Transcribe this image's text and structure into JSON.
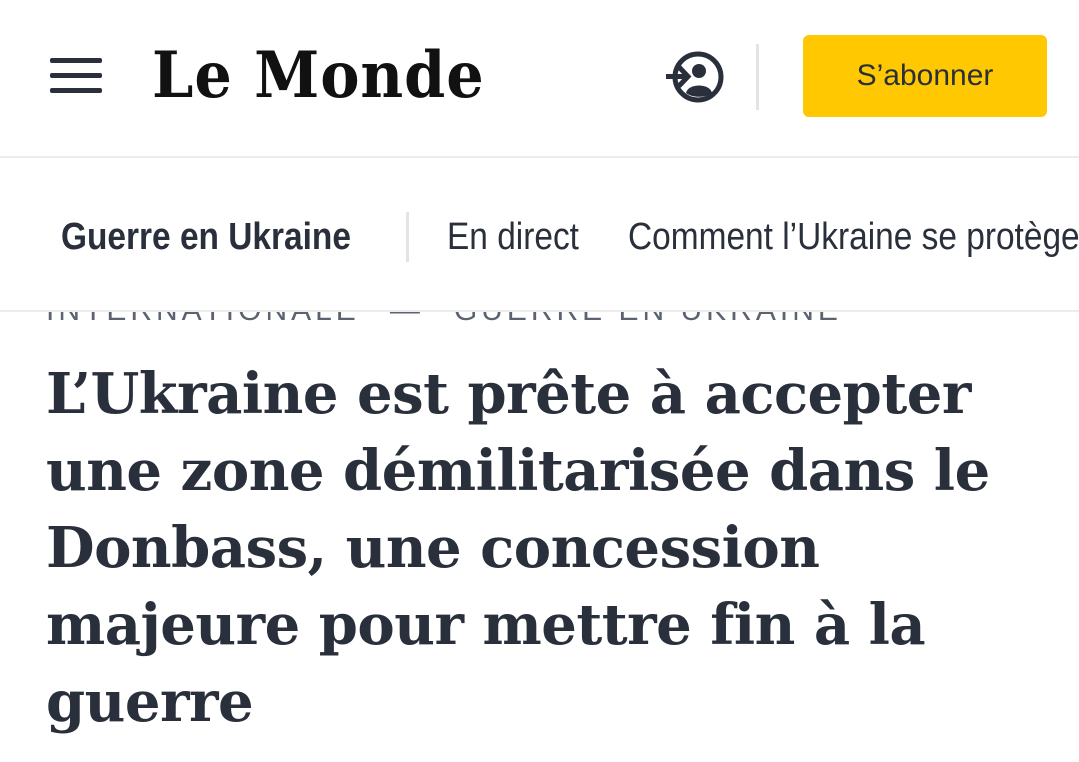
{
  "header": {
    "logo_text": "Le Monde",
    "menu_icon": "hamburger-menu-icon",
    "login_icon": "login-user-icon",
    "subscribe_label": "S’abonner",
    "accent_color": "#ffc800"
  },
  "subnav": {
    "section_label": "Guerre en Ukraine",
    "live_label": "En direct",
    "story_label": "Comment l’Ukraine se protège"
  },
  "article": {
    "breadcrumb": {
      "rubric": "INTERNATIONALE",
      "subrubric": "GUERRE EN UKRAINE"
    },
    "headline": "L’Ukraine est prête à accepter une zone démilitarisée dans le Donbass, une concession majeure pour mettre fin à la guerre"
  }
}
